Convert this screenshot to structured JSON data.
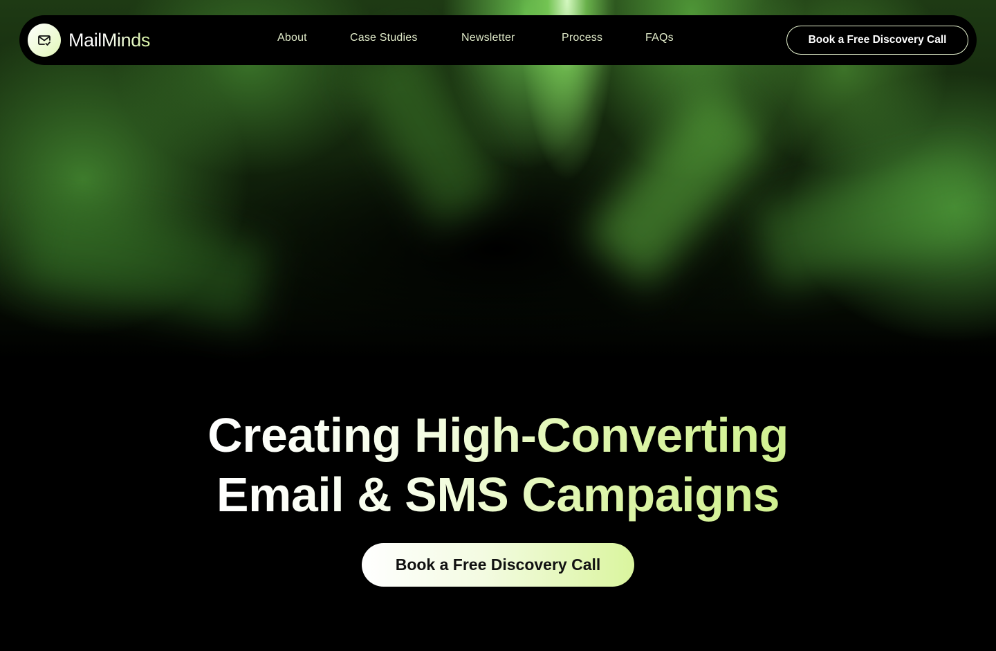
{
  "brand": {
    "name": "MailMinds",
    "logo_icon": "mail-check-icon"
  },
  "nav": {
    "links": [
      {
        "label": "About"
      },
      {
        "label": "Case Studies"
      },
      {
        "label": "Newsletter"
      },
      {
        "label": "Process"
      },
      {
        "label": "FAQs"
      }
    ],
    "cta_label": "Book a Free Discovery Call"
  },
  "hero": {
    "title_line1": "Creating High-Converting",
    "title_line2": "Email & SMS Campaigns",
    "cta_label": "Book a Free Discovery Call"
  },
  "colors": {
    "accent_green": "#d0f090",
    "background": "#000000"
  }
}
